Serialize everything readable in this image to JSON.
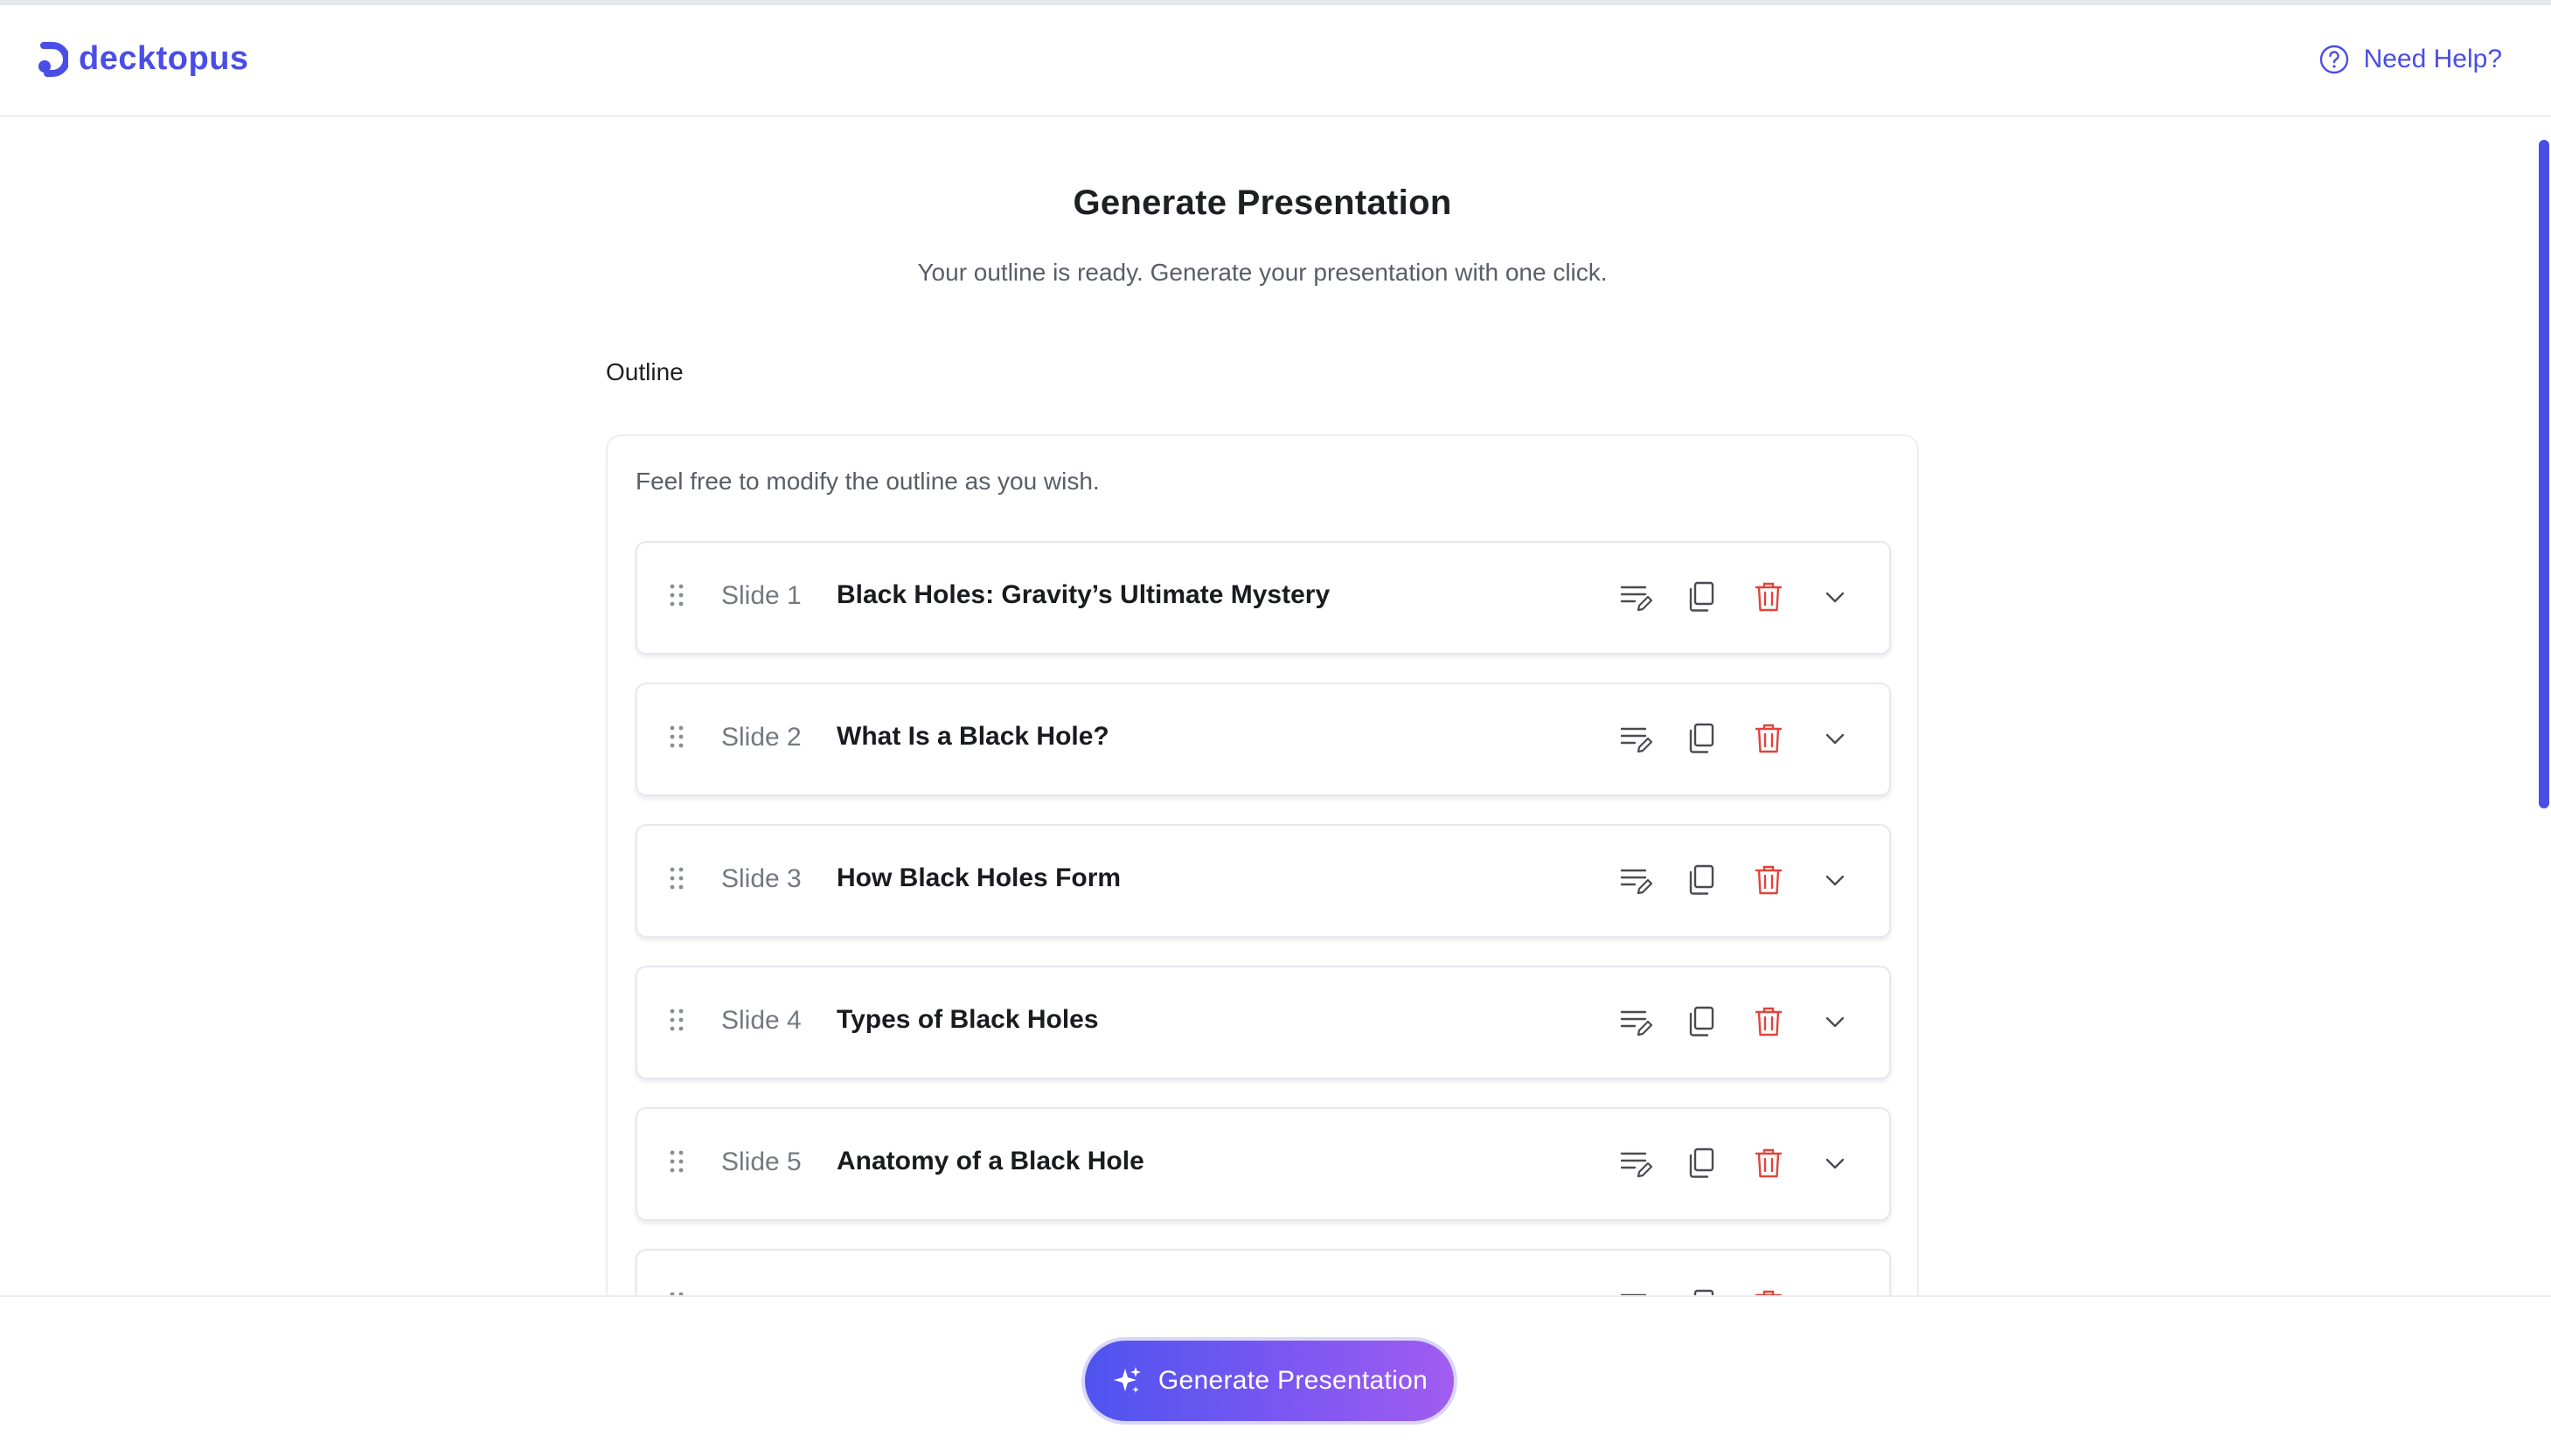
{
  "brand": {
    "name": "decktopus",
    "accent": "#4a4ee6"
  },
  "header": {
    "help_label": "Need Help?",
    "help_icon": "question-circle-icon"
  },
  "page": {
    "title": "Generate Presentation",
    "subtitle": "Your outline is ready. Generate your presentation with one click.",
    "outline_label": "Outline",
    "outline_hint": "Feel free to modify the outline as you wish."
  },
  "slides": [
    {
      "number": "Slide 1",
      "title": "Black Holes: Gravity’s Ultimate Mystery"
    },
    {
      "number": "Slide 2",
      "title": "What Is a Black Hole?"
    },
    {
      "number": "Slide 3",
      "title": "How Black Holes Form"
    },
    {
      "number": "Slide 4",
      "title": "Types of Black Holes"
    },
    {
      "number": "Slide 5",
      "title": "Anatomy of a Black Hole"
    },
    {
      "number": "",
      "title": ""
    }
  ],
  "slide_actions": {
    "icons": [
      "edit-list-icon",
      "duplicate-icon",
      "trash-icon",
      "chevron-down-icon"
    ],
    "delete_color": "#e0443b"
  },
  "footer": {
    "generate_label": "Generate Presentation",
    "generate_icon": "sparkle-icon",
    "gradient": [
      "#4e54ef",
      "#a25cf0"
    ]
  }
}
